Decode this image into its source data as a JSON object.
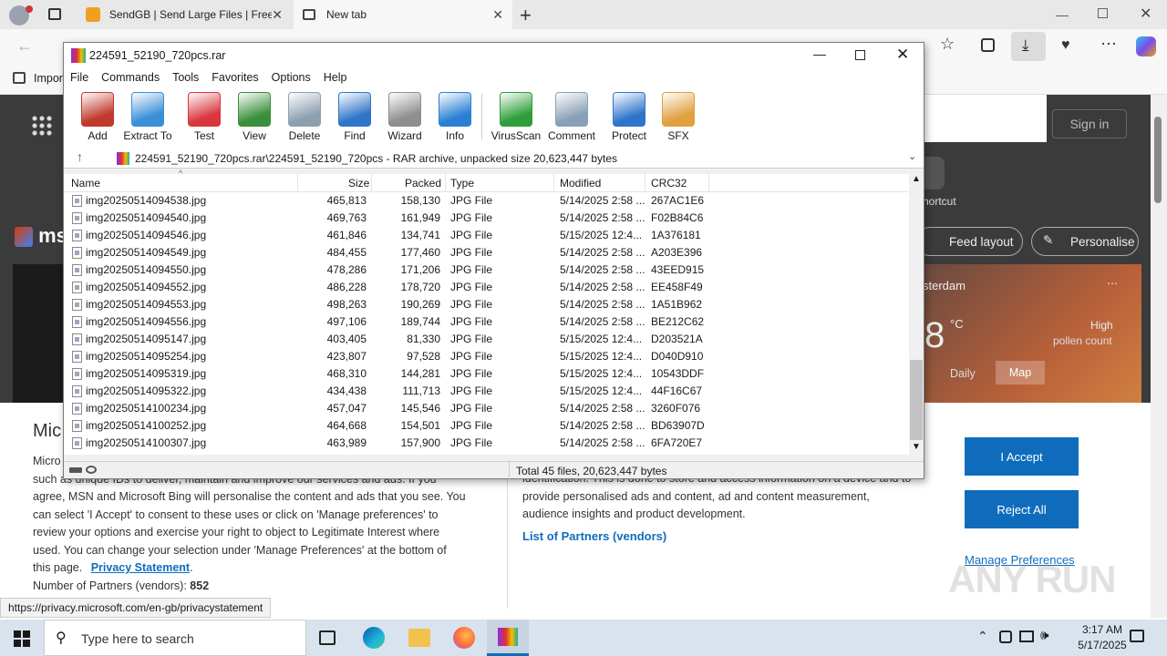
{
  "browser": {
    "tabs": [
      {
        "label": "SendGB | Send Large Files | Free f"
      },
      {
        "label": "New tab"
      }
    ],
    "favorites_item": "Impor",
    "signin_label": "Sign in",
    "shortcut_label": "hortcut",
    "feed_layout_label": "Feed layout",
    "personalise_label": "Personalise",
    "weather": {
      "city": "sterdam",
      "temp": "8",
      "unit": "°C",
      "pollen_line1": "High",
      "pollen_line2": "pollen count",
      "tab_daily": "Daily",
      "tab_map": "Map"
    },
    "logo_text": "ms",
    "status_url": "https://privacy.microsoft.com/en-gb/privacystatement"
  },
  "consent": {
    "heading": "Mic",
    "left_lines": [
      "Micro",
      "such as unique IDs to deliver, maintain and improve our services and ads. If you",
      "agree, MSN and Microsoft Bing will personalise the content and ads that you see. You",
      "can select 'I Accept' to consent to these uses or click on 'Manage preferences' to",
      "review your options and exercise your right to object to Legitimate Interest where",
      "used.  You can change your selection under 'Manage Preferences' at the bottom of"
    ],
    "this_page": "this page.",
    "privacy_link": "Privacy Statement",
    "partners_label": "Number of Partners (vendors):",
    "partners_count": "852",
    "right_lines": [
      "identification. This is done to store and access information on a device and to",
      "provide personalised ads and content, ad and content measurement,",
      "audience insights and product development."
    ],
    "partners_link": "List of Partners (vendors)",
    "accept": "I Accept",
    "reject": "Reject All",
    "manage": "Manage Preferences",
    "watermark": "ANY RUN"
  },
  "winrar": {
    "title": "224591_52190_720pcs.rar",
    "menu": [
      "File",
      "Commands",
      "Tools",
      "Favorites",
      "Options",
      "Help"
    ],
    "tools": [
      {
        "label": "Add",
        "icon": "add-archive-icon",
        "color": "#c0392b"
      },
      {
        "label": "Extract To",
        "icon": "extract-folder-icon",
        "color": "#3b8ed8"
      },
      {
        "label": "Test",
        "icon": "test-checklist-icon",
        "color": "#d9363e"
      },
      {
        "label": "View",
        "icon": "view-book-icon",
        "color": "#3a8f3a"
      },
      {
        "label": "Delete",
        "icon": "delete-trash-icon",
        "color": "#8ea0b0"
      },
      {
        "label": "Find",
        "icon": "find-magnifier-icon",
        "color": "#2f74c9"
      },
      {
        "label": "Wizard",
        "icon": "wizard-wand-icon",
        "color": "#8e8e8e"
      },
      {
        "label": "Info",
        "icon": "info-icon",
        "color": "#2a7fd4"
      },
      {
        "label": "VirusScan",
        "icon": "virus-scan-icon",
        "color": "#2e9e3a"
      },
      {
        "label": "Comment",
        "icon": "comment-icon",
        "color": "#8aa0b8"
      },
      {
        "label": "Protect",
        "icon": "protect-shield-icon",
        "color": "#2f74c9"
      },
      {
        "label": "SFX",
        "icon": "sfx-box-icon",
        "color": "#e0a040"
      }
    ],
    "path": "224591_52190_720pcs.rar\\224591_52190_720pcs - RAR archive, unpacked size 20,623,447 bytes",
    "columns": [
      "Name",
      "Size",
      "Packed",
      "Type",
      "Modified",
      "CRC32"
    ],
    "files": [
      {
        "name": "img20250514094538.jpg",
        "size": "465,813",
        "packed": "158,130",
        "type": "JPG File",
        "modified": "5/14/2025 2:58 ...",
        "crc": "267AC1E6"
      },
      {
        "name": "img20250514094540.jpg",
        "size": "469,763",
        "packed": "161,949",
        "type": "JPG File",
        "modified": "5/14/2025 2:58 ...",
        "crc": "F02B84C6"
      },
      {
        "name": "img20250514094546.jpg",
        "size": "461,846",
        "packed": "134,741",
        "type": "JPG File",
        "modified": "5/15/2025 12:4...",
        "crc": "1A376181"
      },
      {
        "name": "img20250514094549.jpg",
        "size": "484,455",
        "packed": "177,460",
        "type": "JPG File",
        "modified": "5/14/2025 2:58 ...",
        "crc": "A203E396"
      },
      {
        "name": "img20250514094550.jpg",
        "size": "478,286",
        "packed": "171,206",
        "type": "JPG File",
        "modified": "5/14/2025 2:58 ...",
        "crc": "43EED915"
      },
      {
        "name": "img20250514094552.jpg",
        "size": "486,228",
        "packed": "178,720",
        "type": "JPG File",
        "modified": "5/14/2025 2:58 ...",
        "crc": "EE458F49"
      },
      {
        "name": "img20250514094553.jpg",
        "size": "498,263",
        "packed": "190,269",
        "type": "JPG File",
        "modified": "5/14/2025 2:58 ...",
        "crc": "1A51B962"
      },
      {
        "name": "img20250514094556.jpg",
        "size": "497,106",
        "packed": "189,744",
        "type": "JPG File",
        "modified": "5/14/2025 2:58 ...",
        "crc": "BE212C62"
      },
      {
        "name": "img20250514095147.jpg",
        "size": "403,405",
        "packed": "81,330",
        "type": "JPG File",
        "modified": "5/15/2025 12:4...",
        "crc": "D203521A"
      },
      {
        "name": "img20250514095254.jpg",
        "size": "423,807",
        "packed": "97,528",
        "type": "JPG File",
        "modified": "5/15/2025 12:4...",
        "crc": "D040D910"
      },
      {
        "name": "img20250514095319.jpg",
        "size": "468,310",
        "packed": "144,281",
        "type": "JPG File",
        "modified": "5/15/2025 12:4...",
        "crc": "10543DDF"
      },
      {
        "name": "img20250514095322.jpg",
        "size": "434,438",
        "packed": "111,713",
        "type": "JPG File",
        "modified": "5/15/2025 12:4...",
        "crc": "44F16C67"
      },
      {
        "name": "img20250514100234.jpg",
        "size": "457,047",
        "packed": "145,546",
        "type": "JPG File",
        "modified": "5/14/2025 2:58 ...",
        "crc": "3260F076"
      },
      {
        "name": "img20250514100252.jpg",
        "size": "464,668",
        "packed": "154,501",
        "type": "JPG File",
        "modified": "5/14/2025 2:58 ...",
        "crc": "BD63907D"
      },
      {
        "name": "img20250514100307.jpg",
        "size": "463,989",
        "packed": "157,900",
        "type": "JPG File",
        "modified": "5/14/2025 2:58 ...",
        "crc": "6FA720E7"
      }
    ],
    "status": "Total 45 files, 20,623,447 bytes"
  },
  "taskbar": {
    "search_placeholder": "Type here to search",
    "time": "3:17 AM",
    "date": "5/17/2025"
  }
}
